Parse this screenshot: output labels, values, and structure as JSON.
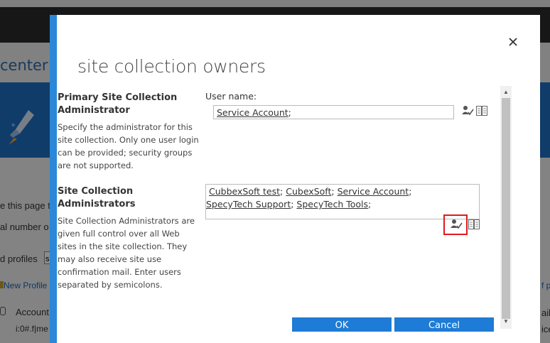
{
  "background": {
    "page_title": "center",
    "line1": "e this page to",
    "line2": "al number o",
    "line3": "d profiles",
    "select_value": "s",
    "new_profile": "New Profile",
    "account_label": "Account",
    "account_value": "i:0#.f|me",
    "right_frag1": "f p",
    "right_frag2": "ail",
    "right_frag3": "ice"
  },
  "dialog": {
    "title": "site collection owners",
    "primary": {
      "heading_line1": "Primary Site Collection",
      "heading_line2": "Administrator",
      "desc_lines": [
        "Specify the administrator for this",
        "site collection. Only one user login",
        "can be provided; security groups",
        "are not supported."
      ],
      "field_label": "User name:",
      "value": "Service Account",
      "sep": ";"
    },
    "admins": {
      "heading_line1": "Site Collection",
      "heading_line2": "Administrators",
      "desc_lines": [
        "Site Collection Administrators are",
        "given full control over all Web",
        "sites in the site collection. They",
        "may also receive site use",
        "confirmation mail. Enter users",
        "separated by semicolons."
      ],
      "users": [
        "CubbexSoft test",
        "CubexSoft",
        "Service Account",
        "SpecyTech Support",
        "SpecyTech Tools"
      ],
      "sep": ";"
    },
    "buttons": {
      "ok": "OK",
      "cancel": "Cancel"
    },
    "close_glyph": "×",
    "icons": {
      "check_names": "check-names-icon",
      "browse": "address-book-icon"
    },
    "colors": {
      "accent": "#2b88d8",
      "button": "#1e7bd6",
      "highlight": "#e0191f"
    }
  }
}
